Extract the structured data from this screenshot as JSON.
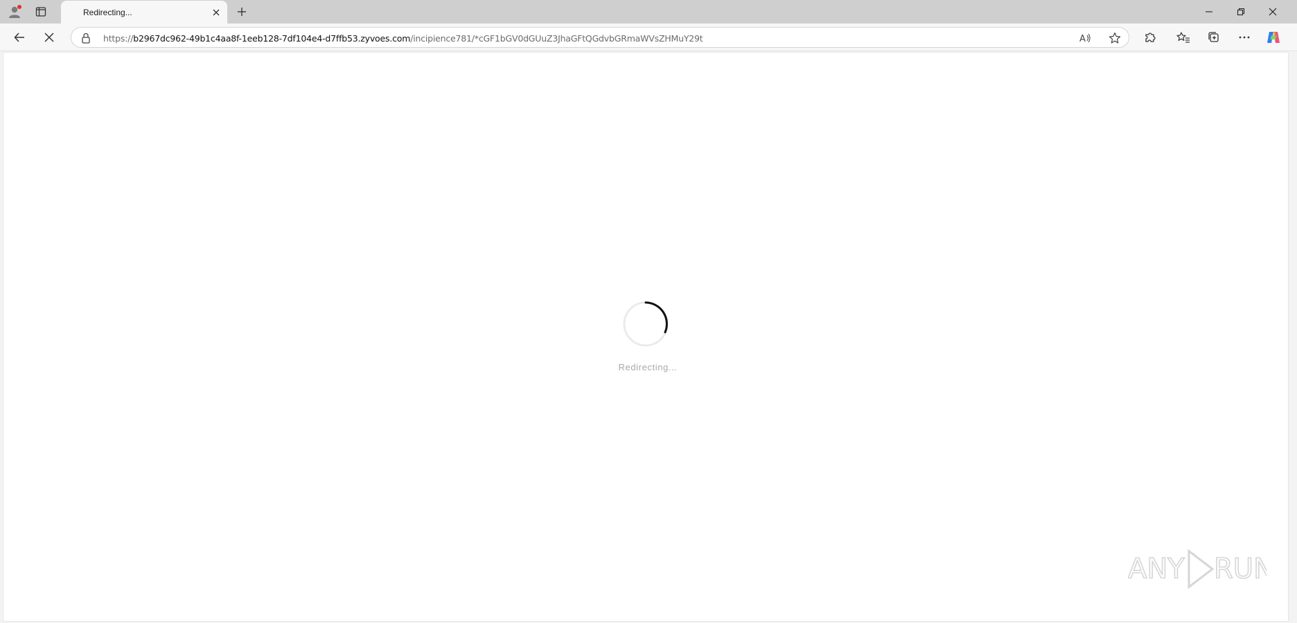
{
  "browser": {
    "tab": {
      "title": "Redirecting..."
    },
    "address": {
      "scheme": "https://",
      "host": "b2967dc962-49b1c4aa8f-1eeb128-7df104e4-d7ffb53.zyvoes.com",
      "path": "/incipience781/*cGF1bGV0dGUuZ3JhaGFtQGdvbGRmaWVsZHMuY29t"
    },
    "icons": {
      "profile": "profile-icon",
      "tab_actions": "tab-actions-icon",
      "close_tab": "close-icon",
      "new_tab": "plus-icon",
      "minimize": "minimize-icon",
      "restore": "restore-icon",
      "close_window": "close-icon",
      "back": "back-arrow-icon",
      "stop": "stop-icon",
      "lock": "lock-icon",
      "read_aloud": "read-aloud-icon",
      "favorite": "star-icon",
      "extensions": "puzzle-icon",
      "favorites": "favorites-icon",
      "collections": "collections-icon",
      "more": "more-icon",
      "copilot": "copilot-icon"
    }
  },
  "page": {
    "status_text": "Redirecting..."
  },
  "watermark": {
    "text": "ANY RUN"
  },
  "colors": {
    "tabstrip": "#cfcfcf",
    "toolbar": "#f7f7f7",
    "spinner_track": "#ebebeb",
    "spinner_arc": "#111111",
    "status_text": "#a8a8a8",
    "profile_badge": "#e0342c"
  }
}
